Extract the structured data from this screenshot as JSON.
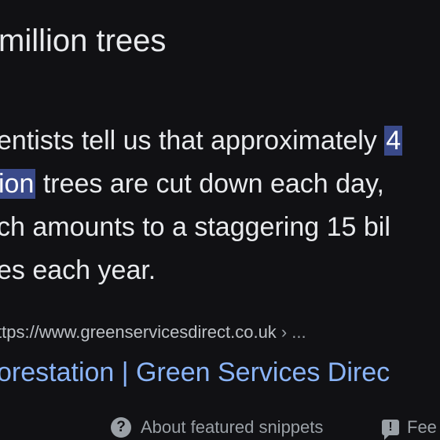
{
  "snippet": {
    "headline": "million trees",
    "lines": [
      {
        "pre": "entists tell us that approximately ",
        "hl": "4",
        "post": ""
      },
      {
        "pre": "",
        "hl": "ion",
        "post": " trees are cut down each day,"
      },
      {
        "pre": "ch amounts to a staggering 15 bil",
        "hl": "",
        "post": ""
      },
      {
        "pre": "es each year.",
        "hl": "",
        "post": ""
      }
    ]
  },
  "source": {
    "url": "ttps://www.greenservicesdirect.co.uk",
    "breadcrumb_sep": "› ...",
    "title": "orestation | Green Services Direc"
  },
  "footer": {
    "about_label": "About featured snippets",
    "about_icon": "?",
    "feedback_label": "Fee",
    "feedback_icon": "!"
  },
  "colors": {
    "background": "#111114",
    "text": "#e8eaed",
    "highlight": "#3a4a8a",
    "link": "#8ab4f8",
    "muted": "#9aa0a6"
  }
}
